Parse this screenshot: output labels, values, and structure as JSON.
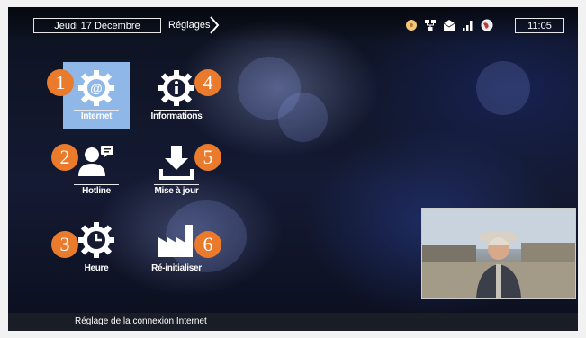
{
  "header": {
    "date": "Jeudi 17 Décembre",
    "breadcrumb": "Réglages",
    "time": "11:05",
    "status_icons": [
      "disc-icon",
      "network-icon",
      "mail-icon",
      "signal-icon",
      "globe-icon"
    ]
  },
  "menu": [
    {
      "number": "1",
      "label": "Internet",
      "icon": "gear-at-icon",
      "selected": true
    },
    {
      "number": "2",
      "label": "Hotline",
      "icon": "support-person-icon",
      "selected": false
    },
    {
      "number": "3",
      "label": "Heure",
      "icon": "gear-clock-icon",
      "selected": false
    },
    {
      "number": "4",
      "label": "Informations",
      "icon": "gear-info-icon",
      "selected": false
    },
    {
      "number": "5",
      "label": "Mise à jour",
      "icon": "download-icon",
      "selected": false
    },
    {
      "number": "6",
      "label": "Ré-initialiser",
      "icon": "factory-icon",
      "selected": false
    }
  ],
  "footer": {
    "help_text": "Réglage de la connexion Internet"
  },
  "colors": {
    "badge": "#ea7a2c",
    "selected_tile": "#8fb8e8"
  }
}
